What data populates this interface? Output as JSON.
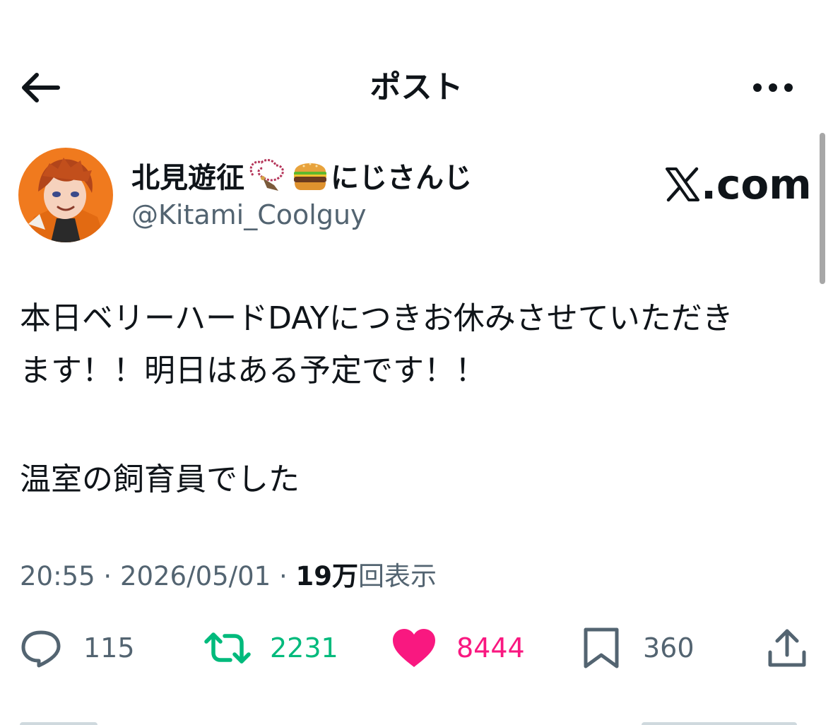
{
  "header": {
    "title": "ポスト",
    "back_icon": "arrow-left-icon",
    "more_icon": "more-horizontal-icon"
  },
  "author": {
    "display_name": "北見遊征",
    "name_emojis": [
      "prayer-beads-icon",
      "hamburger-icon"
    ],
    "name_suffix": "にじさんじ",
    "handle": "@Kitami_Coolguy",
    "avatar": "avatar"
  },
  "watermark": {
    "text": ".com",
    "icon": "x-logo-icon"
  },
  "post": {
    "line1": "本日ベリーハードDAYにつきお休みさせていただき",
    "line2": "ます！！明日はある予定です！！",
    "line3": "温室の飼育員でした"
  },
  "meta": {
    "time": "20:55",
    "separator": " · ",
    "date": "2026/05/01",
    "views_count": "19万",
    "views_label": "回表示"
  },
  "actions": {
    "replies": "115",
    "reposts": "2231",
    "likes": "8444",
    "bookmarks": "360"
  },
  "colors": {
    "text": "#0f1419",
    "secondary": "#536471",
    "repost": "#00ba7c",
    "like": "#f91880"
  }
}
